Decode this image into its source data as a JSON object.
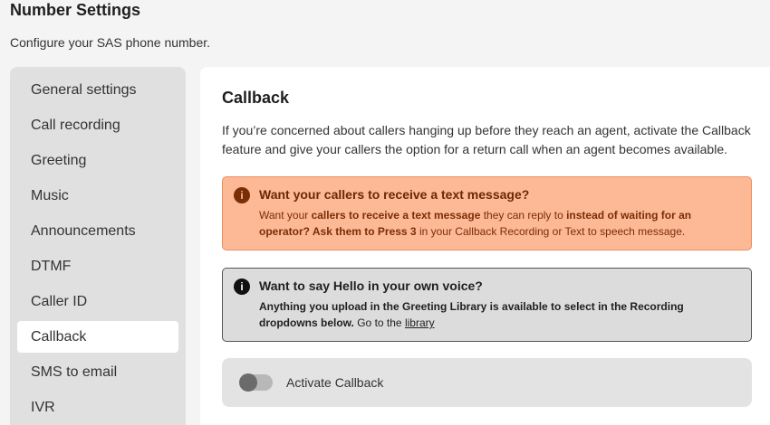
{
  "header": {
    "title": "Number Settings",
    "subtitle": "Configure your SAS phone number."
  },
  "sidebar": {
    "items": [
      {
        "label": "General settings"
      },
      {
        "label": "Call recording"
      },
      {
        "label": "Greeting"
      },
      {
        "label": "Music"
      },
      {
        "label": "Announcements"
      },
      {
        "label": "DTMF"
      },
      {
        "label": "Caller ID"
      },
      {
        "label": "Callback",
        "active": true
      },
      {
        "label": "SMS to email"
      },
      {
        "label": "IVR"
      }
    ]
  },
  "main": {
    "title": "Callback",
    "description": "If you’re concerned about callers hanging up before they reach an agent, activate the Callback feature and give your callers the option for a return call when an agent becomes available.",
    "warning": {
      "icon": "info-icon",
      "title": "Want your callers to receive a text message?",
      "text_plain1": "Want your ",
      "text_bold1": "callers to receive a text message",
      "text_plain2": " they can reply to ",
      "text_bold2": "instead of waiting for an operator? Ask them to Press 3",
      "text_plain3": " in your Callback Recording or Text to speech message."
    },
    "info": {
      "icon": "info-icon",
      "title": "Want to say Hello in your own voice?",
      "text_bold": "Anything you upload in the Greeting Library is available to select in the Recording dropdowns below.",
      "text_plain": " Go to the ",
      "link": "library"
    },
    "toggle": {
      "label": "Activate Callback",
      "checked": false
    }
  },
  "colors": {
    "warning_bg": "#fdb896",
    "warning_text": "#7a2e06",
    "info_bg": "#dcdcdc"
  }
}
